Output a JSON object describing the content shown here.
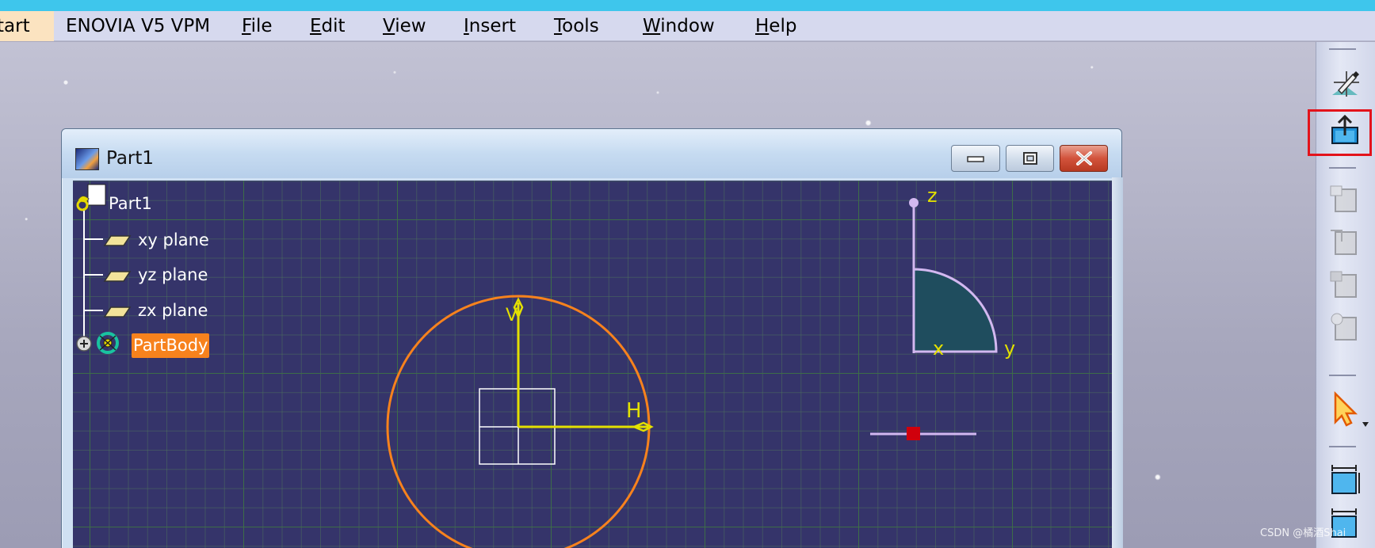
{
  "menubar": {
    "start_label": "tart",
    "items": [
      {
        "id": "enovia",
        "label": "ENOVIA V5 VPM",
        "mnemonic": ""
      },
      {
        "id": "file",
        "label": "File",
        "mnemonic": "F"
      },
      {
        "id": "edit",
        "label": "Edit",
        "mnemonic": "E"
      },
      {
        "id": "view",
        "label": "View",
        "mnemonic": "V"
      },
      {
        "id": "insert",
        "label": "Insert",
        "mnemonic": "I"
      },
      {
        "id": "tools",
        "label": "Tools",
        "mnemonic": "T"
      },
      {
        "id": "window",
        "label": "Window",
        "mnemonic": "W"
      },
      {
        "id": "help",
        "label": "Help",
        "mnemonic": "H"
      }
    ]
  },
  "window": {
    "title": "Part1",
    "icon": "catia-document-icon"
  },
  "tree": {
    "root": "Part1",
    "items": [
      "xy plane",
      "yz plane",
      "zx plane"
    ],
    "body": "PartBody"
  },
  "sketch": {
    "v_label": "V",
    "h_label": "H"
  },
  "compass": {
    "z_label": "z",
    "y_label": "y",
    "x_label": "x"
  },
  "toolbar": {
    "icons": [
      "sketcher-icon",
      "exit-workbench-icon",
      "feature-icon-1",
      "feature-icon-2",
      "feature-icon-3",
      "feature-icon-4",
      "select-arrow-icon",
      "constraint-icon-1",
      "constraint-icon-2"
    ],
    "highlighted": "exit-workbench-icon"
  },
  "watermark": "CSDN @橘酒Shai",
  "colors": {
    "viewport_bg": "#35346a",
    "grid": "#3d6d48",
    "circle": "#f7821d",
    "axis": "#e3e000",
    "highlight": "#e3131b",
    "selected_bg": "#f7821d"
  }
}
